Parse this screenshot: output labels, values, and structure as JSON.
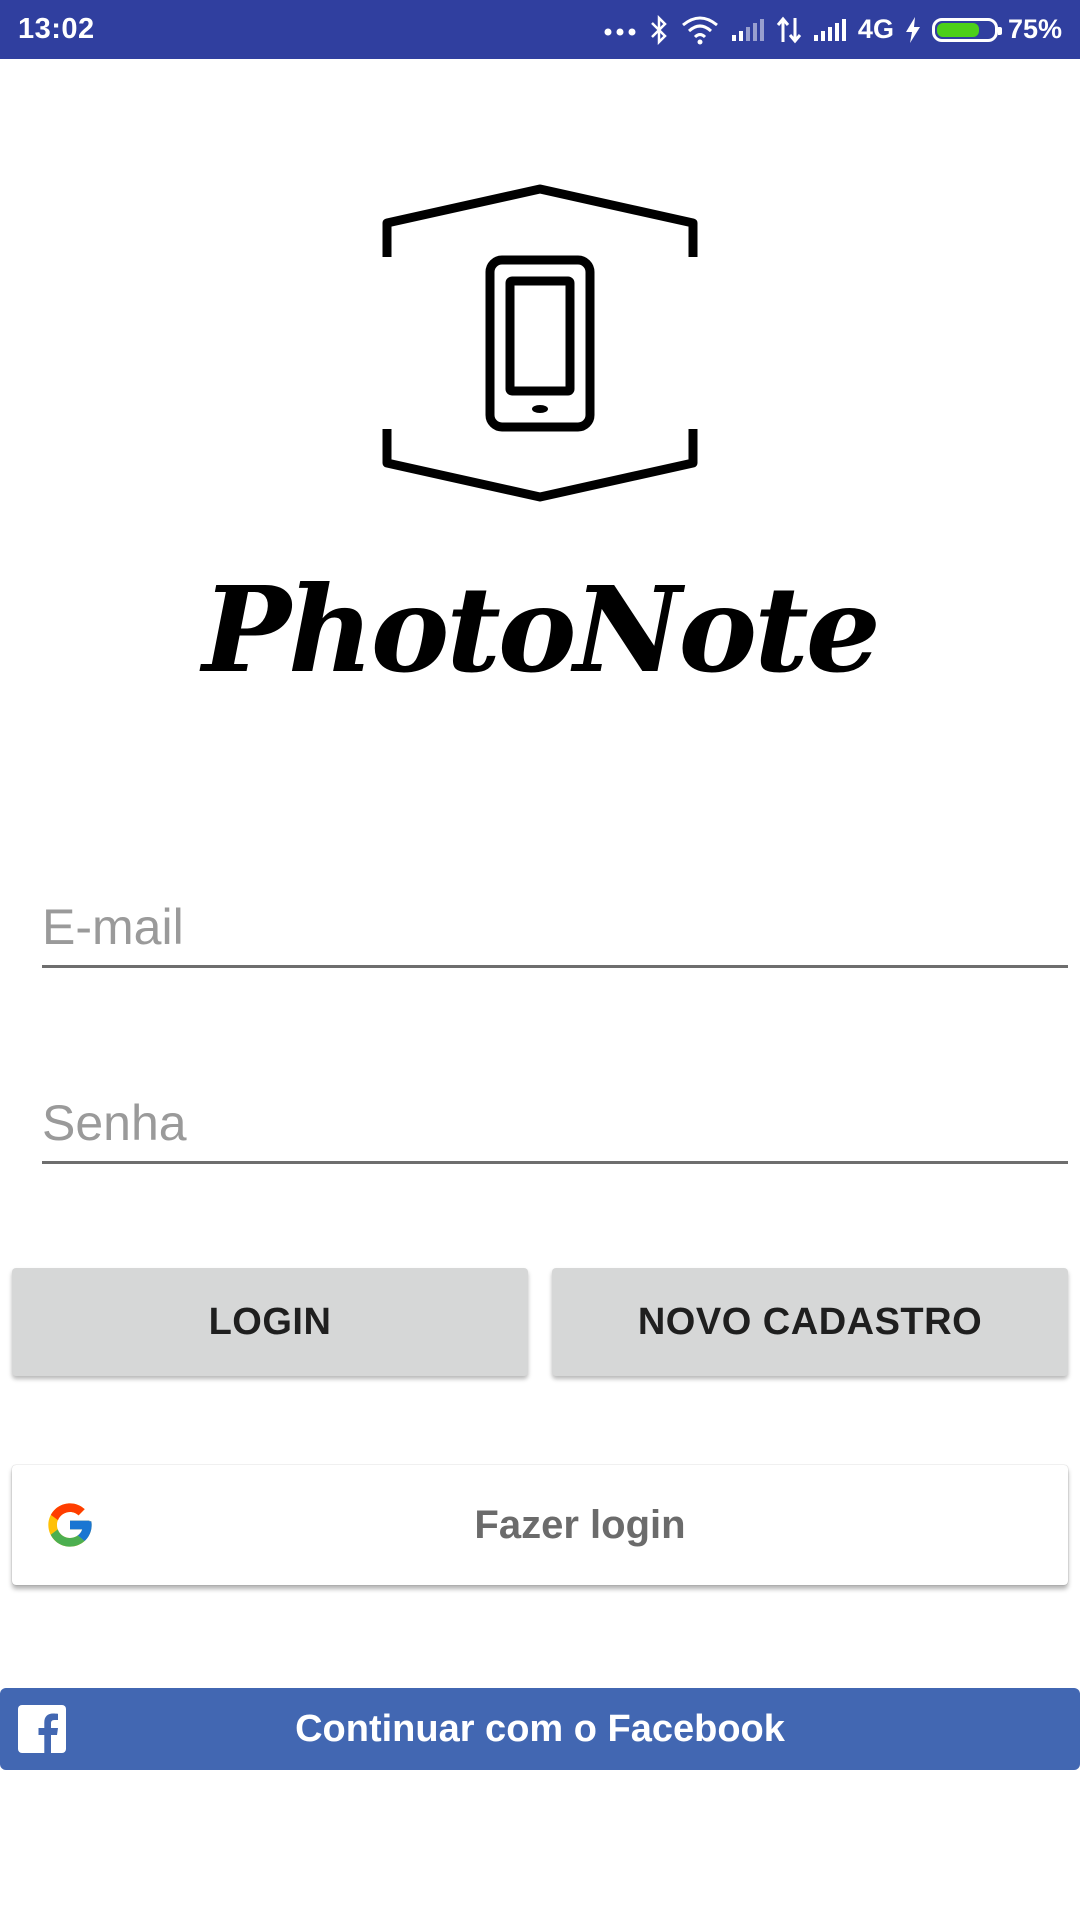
{
  "status_bar": {
    "time": "13:02",
    "network": "4G",
    "battery_percent": "75%",
    "battery_level": 0.75,
    "background_color": "#303F9F",
    "icons": [
      "more-dots-icon",
      "bluetooth-icon",
      "wifi-icon",
      "signal-icon",
      "data-transfer-icon",
      "signal-icon",
      "charging-icon",
      "battery-icon"
    ]
  },
  "logo": {
    "icon": "smartphone-frame-logo",
    "brand_name": "PhotoNote"
  },
  "form": {
    "email_placeholder": "E-mail",
    "email_value": "",
    "password_placeholder": "Senha",
    "password_value": ""
  },
  "buttons": {
    "login_label": "LOGIN",
    "signup_label": "NOVO CADASTRO",
    "google_label": "Fazer login",
    "facebook_label": "Continuar com o Facebook"
  },
  "colors": {
    "facebook_blue": "#4267B2",
    "button_gray": "#D6D7D7",
    "battery_green": "#4CCF1A"
  }
}
